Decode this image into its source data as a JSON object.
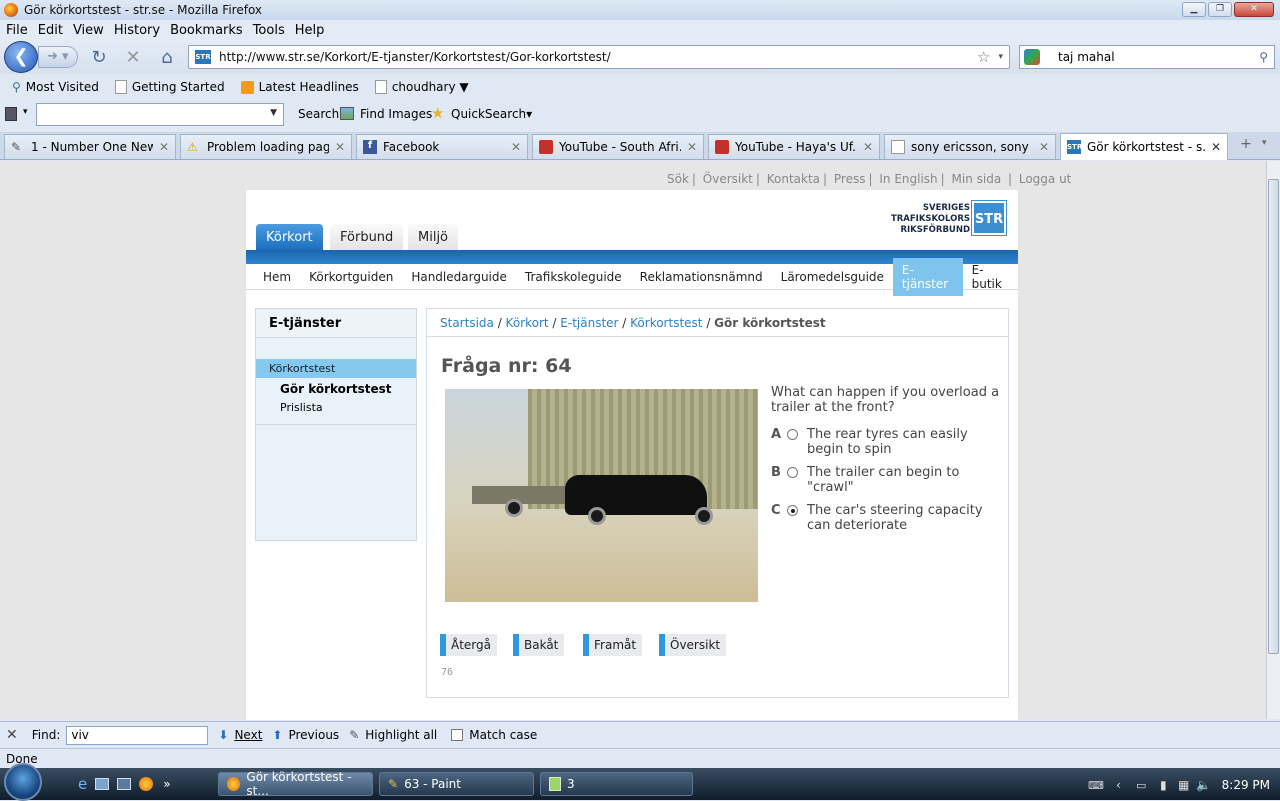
{
  "window": {
    "title": "Gör körkortstest - str.se - Mozilla Firefox"
  },
  "menu": [
    "File",
    "Edit",
    "View",
    "History",
    "Bookmarks",
    "Tools",
    "Help"
  ],
  "url": "http://www.str.se/Korkort/E-tjanster/Korkortstest/Gor-korkortstest/",
  "search": {
    "value": "taj mahal"
  },
  "bookmarks": [
    "Most Visited",
    "Getting Started",
    "Latest Headlines",
    "choudhary ▼"
  ],
  "toolbar2": {
    "search": "Search",
    "find_images": "Find Images",
    "quicksearch": "QuickSearch▾"
  },
  "tabs": [
    {
      "label": "1 - Number One New..."
    },
    {
      "label": "Problem loading page"
    },
    {
      "label": "Facebook"
    },
    {
      "label": "YouTube - South Afri..."
    },
    {
      "label": "YouTube - Haya's Uf..."
    },
    {
      "label": "sony ericsson, sony e..."
    },
    {
      "label": "Gör körkortstest - s..."
    }
  ],
  "page": {
    "topnav": [
      "Sök",
      "Översikt",
      "Kontakta",
      "Press",
      "In English",
      "Min sida",
      "Logga ut"
    ],
    "logo": {
      "line1": "SVERIGES",
      "line2": "TRAFIKSKOLORS",
      "line3": "RIKSFÖRBUND",
      "mark": "STR"
    },
    "maintabs": [
      "Körkort",
      "Förbund",
      "Miljö"
    ],
    "subnav": [
      "Hem",
      "Körkortguiden",
      "Handledarguide",
      "Trafikskoleguide",
      "Reklamationsnämnd",
      "Läromedelsguide",
      "E-tjänster",
      "E-butik"
    ],
    "sidebar": {
      "heading": "E-tjänster",
      "current": "Körkortstest",
      "sub1": "Gör körkortstest",
      "sub2": "Prislista"
    },
    "breadcrumb": {
      "a": "Startsida",
      "b": "Körkort",
      "c": "E-tjänster",
      "d": "Körkortstest",
      "current": "Gör körkortstest"
    },
    "question_title": "Fråga nr: 64",
    "question": "What can happen if you overload a trailer at the front?",
    "answers": [
      {
        "letter": "A",
        "text": "The rear tyres can easily begin to spin"
      },
      {
        "letter": "B",
        "text": "The trailer can begin to \"crawl\""
      },
      {
        "letter": "C",
        "text": "The car's steering capacity can deteriorate"
      }
    ],
    "selected_answer": "C",
    "buttons": [
      "Återgå",
      "Bakåt",
      "Framåt",
      "Översikt"
    ],
    "page_number": "76"
  },
  "find": {
    "label": "Find:",
    "value": "viv",
    "next": "Next",
    "previous": "Previous",
    "highlight": "Highlight all",
    "match_case": "Match case"
  },
  "status": "Done",
  "taskbar": {
    "items": [
      "Gör körkortstest - st...",
      "63 - Paint",
      "3"
    ],
    "clock": "8:29 PM"
  }
}
